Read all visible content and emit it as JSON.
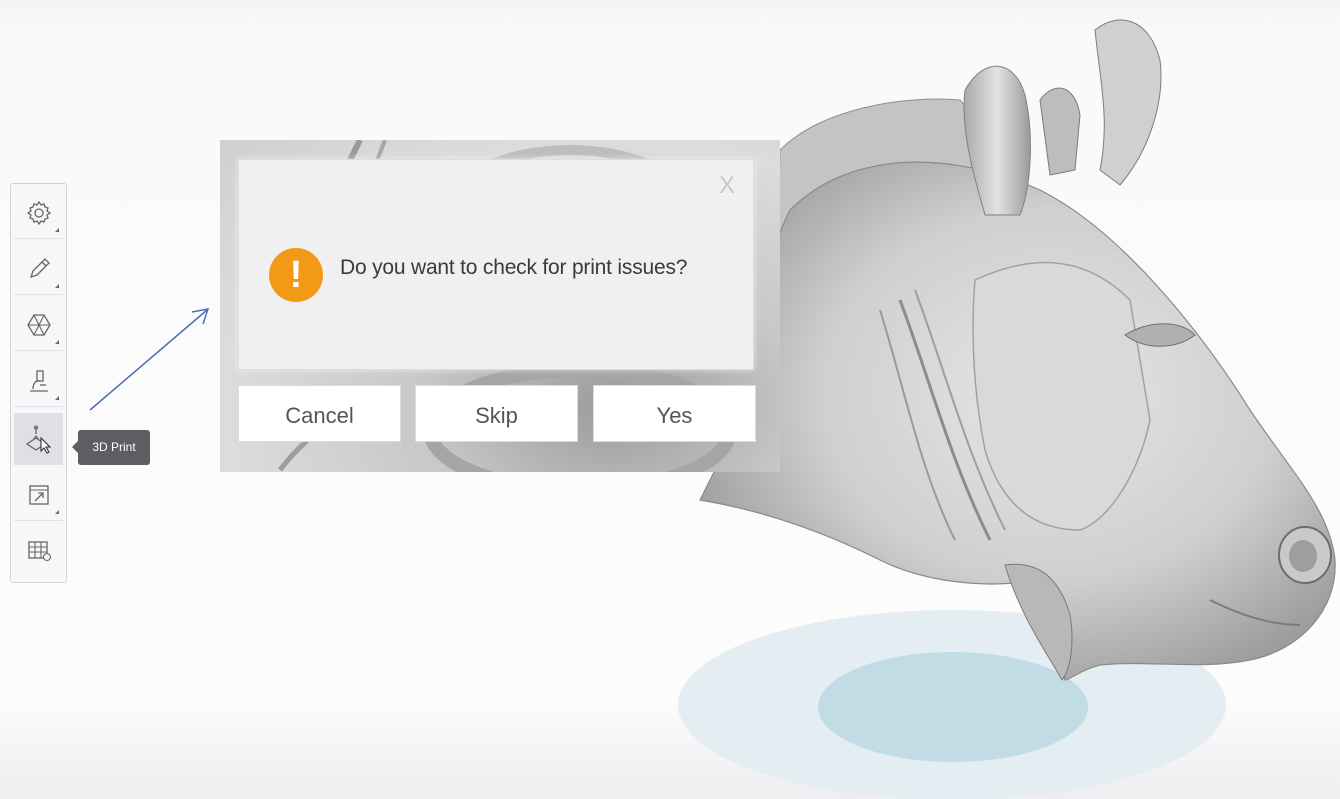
{
  "toolbar": {
    "items": [
      {
        "name": "settings",
        "icon": "gear-icon"
      },
      {
        "name": "edit",
        "icon": "pencil-icon"
      },
      {
        "name": "mesh",
        "icon": "mesh-icon"
      },
      {
        "name": "inspect",
        "icon": "microscope-icon"
      },
      {
        "name": "3d-print",
        "icon": "3d-print-icon",
        "active": true
      },
      {
        "name": "export",
        "icon": "export-icon"
      },
      {
        "name": "layout",
        "icon": "grid-icon"
      }
    ],
    "tooltip": "3D Print"
  },
  "dialog": {
    "close_glyph": "X",
    "warning_glyph": "!",
    "message": "Do you want to check for print issues?",
    "buttons": {
      "cancel": "Cancel",
      "skip": "Skip",
      "yes": "Yes"
    }
  },
  "colors": {
    "warning": "#f29a16",
    "arrow": "#4a6fb0",
    "platform_outer": "#e4eef2",
    "platform_inner": "#c2dce6"
  }
}
